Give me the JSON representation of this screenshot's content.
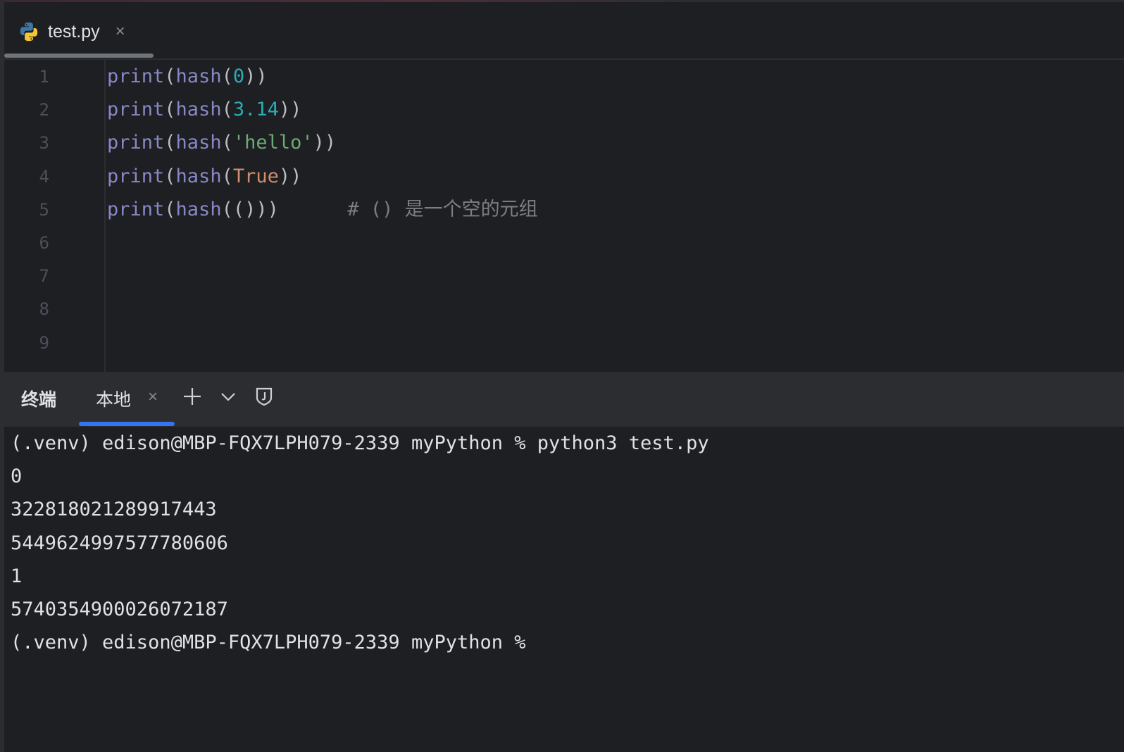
{
  "editor": {
    "tab": {
      "filename": "test.py",
      "close": "×"
    },
    "line_numbers": [
      "1",
      "2",
      "3",
      "4",
      "5",
      "6",
      "7",
      "8",
      "9"
    ],
    "lines": [
      [
        {
          "t": "print",
          "c": "kw"
        },
        {
          "t": "(",
          "c": "p"
        },
        {
          "t": "hash",
          "c": "kw"
        },
        {
          "t": "(",
          "c": "p"
        },
        {
          "t": "0",
          "c": "num"
        },
        {
          "t": "))",
          "c": "p"
        }
      ],
      [
        {
          "t": "print",
          "c": "kw"
        },
        {
          "t": "(",
          "c": "p"
        },
        {
          "t": "hash",
          "c": "kw"
        },
        {
          "t": "(",
          "c": "p"
        },
        {
          "t": "3.14",
          "c": "num"
        },
        {
          "t": "))",
          "c": "p"
        }
      ],
      [
        {
          "t": "print",
          "c": "kw"
        },
        {
          "t": "(",
          "c": "p"
        },
        {
          "t": "hash",
          "c": "kw"
        },
        {
          "t": "(",
          "c": "p"
        },
        {
          "t": "'hello'",
          "c": "str"
        },
        {
          "t": "))",
          "c": "p"
        }
      ],
      [
        {
          "t": "print",
          "c": "kw"
        },
        {
          "t": "(",
          "c": "p"
        },
        {
          "t": "hash",
          "c": "kw"
        },
        {
          "t": "(",
          "c": "p"
        },
        {
          "t": "True",
          "c": "bool"
        },
        {
          "t": "))",
          "c": "p"
        }
      ],
      [
        {
          "t": "print",
          "c": "kw"
        },
        {
          "t": "(",
          "c": "p"
        },
        {
          "t": "hash",
          "c": "kw"
        },
        {
          "t": "(()))",
          "c": "p"
        },
        {
          "t": "      # () 是一个空的元组",
          "c": "cmt"
        }
      ],
      [],
      [],
      [],
      []
    ]
  },
  "terminal": {
    "title": "终端",
    "tab_label": "本地",
    "tab_close": "×",
    "lines": [
      "(.venv) edison@MBP-FQX7LPH079-2339 myPython % python3 test.py",
      "0",
      "322818021289917443",
      "5449624997577780606",
      "1",
      "5740354900026072187",
      "(.venv) edison@MBP-FQX7LPH079-2339 myPython %"
    ]
  }
}
